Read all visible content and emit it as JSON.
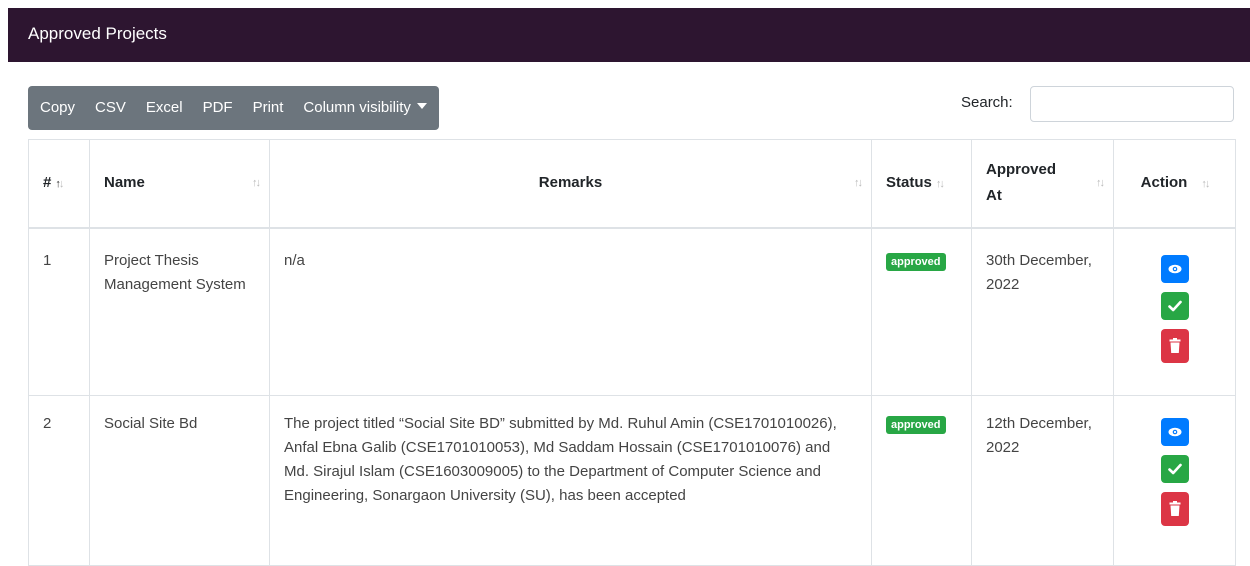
{
  "header": {
    "title": "Approved Projects"
  },
  "toolbar": {
    "buttons": [
      "Copy",
      "CSV",
      "Excel",
      "PDF",
      "Print"
    ],
    "column_visibility": "Column visibility"
  },
  "search": {
    "label": "Search:",
    "value": ""
  },
  "table": {
    "columns": [
      "#",
      "Name",
      "Remarks",
      "Status",
      "Approved At",
      "Action"
    ],
    "rows": [
      {
        "num": "1",
        "name": "Project Thesis Management System",
        "remarks": "n/a",
        "status": "approved",
        "approved_at": "30th December, 2022"
      },
      {
        "num": "2",
        "name": "Social Site Bd",
        "remarks": "The project titled “Social Site BD” submitted by Md. Ruhul Amin (CSE1701010026), Anfal Ebna Galib (CSE1701010053), Md Saddam Hossain (CSE1701010076) and Md. Sirajul Islam (CSE1603009005) to the Department of Computer Science and Engineering, Sonargaon University (SU), has been accepted",
        "status": "approved",
        "approved_at": "12th December, 2022"
      }
    ]
  },
  "icons": {
    "view": "eye-icon",
    "approve": "check-icon",
    "delete": "trash-icon"
  },
  "colors": {
    "header_bg": "#2d1530",
    "toolbar_bg": "#6c757d",
    "view": "#007bff",
    "approve": "#28a745",
    "delete": "#dc3545",
    "badge": "#28a745"
  }
}
